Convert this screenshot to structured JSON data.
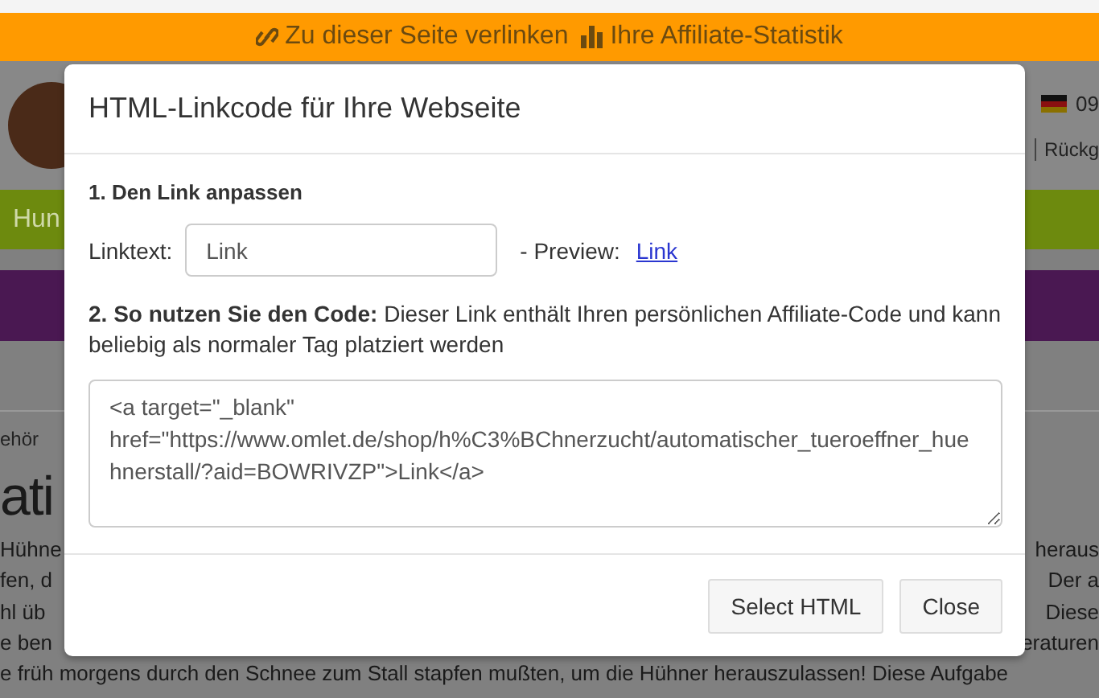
{
  "top_bar": {
    "links": [
      {
        "kind": "link",
        "label": "Zu dieser Seite verlinken"
      },
      {
        "kind": "stats",
        "label": "Ihre Affiliate-Statistik"
      }
    ]
  },
  "background": {
    "header_right": {
      "code": "09",
      "link": "Rückg"
    },
    "nav_item": "Hun",
    "breadcrumb": "ehör",
    "heading": "ati",
    "lines": [
      {
        "left": "Hühne",
        "right": "heraus"
      },
      {
        "left": "fen, d",
        "right": "Der a"
      },
      {
        "left": "hl üb",
        "right": "Diese"
      },
      {
        "left": "e ben",
        "right": "eraturen"
      },
      {
        "left": "e früh morgens durch den Schnee zum Stall stapfen mußten, um die Hühner herauszulassen! Diese Aufgabe"
      }
    ]
  },
  "modal": {
    "title": "HTML-Linkcode für Ihre Webseite",
    "step1": "1. Den Link anpassen",
    "field_label": "Linktext:",
    "field_value": "Link",
    "preview_label": "- Preview:",
    "preview_link": "Link",
    "step2": "**2. So nutzen Sie den Code:** Dieser Link enthält Ihren persönlichen Affiliate-Code und kann beliebig als normaler Tag platziert werden",
    "code": "<a target=\"_blank\" href=\"https://www.omlet.de/shop/h%C3%BChnerzucht/automatischer_tueroeffner_huehnerstall/?aid=BOWRIVZP\">Link</a>",
    "buttons": [
      "Select HTML",
      "Close"
    ]
  }
}
